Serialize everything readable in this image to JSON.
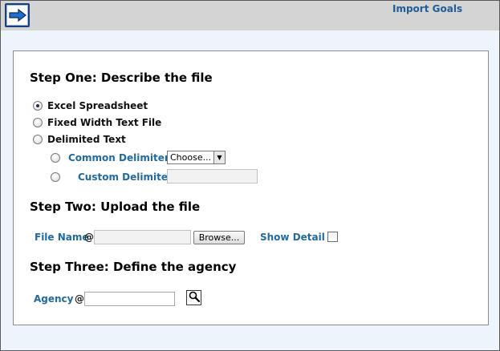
{
  "header": {
    "nav_icon": "arrow-right-icon",
    "title": "Import Goals"
  },
  "step_one": {
    "heading": "Step One: Describe the file",
    "options": [
      {
        "label": "Excel Spreadsheet",
        "checked": true
      },
      {
        "label": "Fixed Width Text File",
        "checked": false
      },
      {
        "label": "Delimited Text",
        "checked": false
      }
    ],
    "delimiters": {
      "common_label": "Common Delimiters",
      "common_selected": "Choose...",
      "custom_label": "Custom Delimiter",
      "custom_value": ""
    }
  },
  "step_two": {
    "heading": "Step Two: Upload the file",
    "file_label": "File Name",
    "required_marker": "@",
    "file_value": "",
    "browse_label": "Browse...",
    "show_detail_label": "Show Detail",
    "show_detail_checked": false
  },
  "step_three": {
    "heading": "Step Three: Define the agency",
    "agency_label": "Agency",
    "required_marker": "@",
    "agency_value": "",
    "lookup_icon": "magnifier-icon"
  },
  "colors": {
    "accent": "#1f6aa5",
    "header_bg": "#d4d4d4",
    "page_bg": "#eef4fb"
  }
}
